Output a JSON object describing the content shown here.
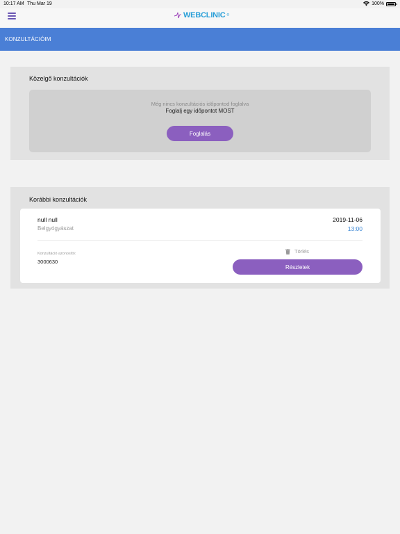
{
  "status_bar": {
    "time": "10:17 AM",
    "date": "Thu Mar 19",
    "battery": "100%",
    "icons": [
      "wifi-icon",
      "battery-icon"
    ]
  },
  "app": {
    "logo_text": "WEBCLINIC",
    "logo_mark": "®",
    "menu_icon": "hamburger-menu-icon"
  },
  "nav": {
    "title": "KONZULTÁCIÓIM"
  },
  "upcoming": {
    "title": "Közelgő konzultációk",
    "empty_line1": "Még nincs konzultációs időpontod foglalva",
    "empty_line2": "Foglalj egy időpontot MOST",
    "book_button": "Foglalás"
  },
  "previous": {
    "title": "Korábbi konzultációk",
    "items": [
      {
        "name": "null null",
        "specialty": "Belgyógyászat",
        "date": "2019-11-06",
        "time": "13:00",
        "id_label": "Konzultáció azonosító:",
        "id_value": "3000630",
        "delete_label": "Törlés",
        "details_button": "Részletek"
      }
    ]
  },
  "colors": {
    "accent_purple": "#8b5fbf",
    "nav_blue": "#4a7fd6",
    "time_blue": "#3a86d4",
    "logo_blue": "#2a9fd8"
  }
}
